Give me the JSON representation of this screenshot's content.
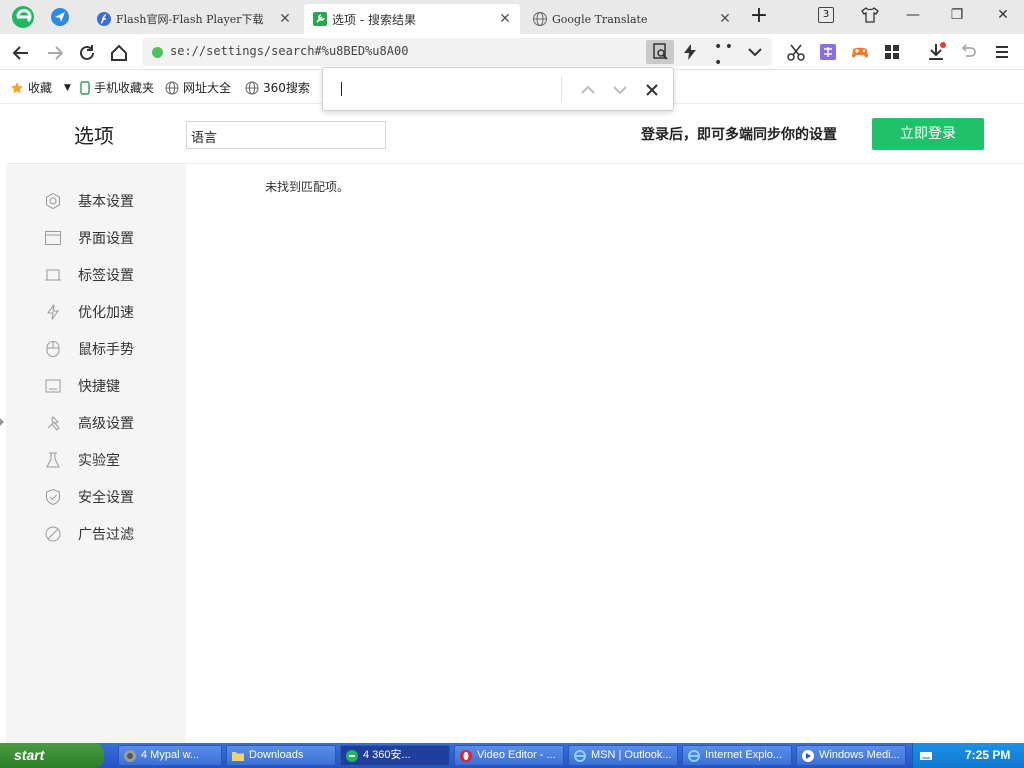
{
  "tabs": [
    {
      "title": "Flash官网-Flash Player下载",
      "icon": "flash-icon"
    },
    {
      "title": "选项 - 搜索结果",
      "icon": "wrench-icon",
      "active": true
    },
    {
      "title": "Google Translate",
      "icon": "globe-icon"
    }
  ],
  "tab_count": "3",
  "address": {
    "url": "se://settings/search#%u8BED%u8A00"
  },
  "bookmarks": [
    {
      "label": "收藏",
      "icon": "star-icon"
    },
    {
      "label": "手机收藏夹",
      "icon": "phone-icon"
    },
    {
      "label": "网址大全",
      "icon": "globe-icon"
    },
    {
      "label": "360搜索",
      "icon": "globe-icon"
    }
  ],
  "find_bar": {
    "value": ""
  },
  "settings": {
    "title": "选项",
    "search_value": "语言",
    "sync_text": "登录后，即可多端同步你的设置",
    "login_button": "立即登录",
    "no_result": "未找到匹配项。",
    "menu": [
      {
        "label": "基本设置",
        "icon": "gear-icon"
      },
      {
        "label": "界面设置",
        "icon": "window-icon"
      },
      {
        "label": "标签设置",
        "icon": "tab-icon"
      },
      {
        "label": "优化加速",
        "icon": "lightning-icon"
      },
      {
        "label": "鼠标手势",
        "icon": "mouse-icon"
      },
      {
        "label": "快捷键",
        "icon": "keyboard-icon"
      },
      {
        "label": "高级设置",
        "icon": "wrench-icon"
      },
      {
        "label": "实验室",
        "icon": "flask-icon"
      },
      {
        "label": "安全设置",
        "icon": "shield-icon"
      },
      {
        "label": "广告过滤",
        "icon": "block-icon"
      }
    ]
  },
  "taskbar": {
    "start_label": "start",
    "tasks": [
      {
        "label": "4 Mypal w...",
        "icon": "mypal-icon"
      },
      {
        "label": "Downloads",
        "icon": "folder-icon"
      },
      {
        "label": "4 360安...",
        "icon": "ie360-icon"
      },
      {
        "label": "Video Editor - ...",
        "icon": "opera-icon"
      },
      {
        "label": "MSN | Outlook...",
        "icon": "ie-icon"
      },
      {
        "label": "Internet Explo...",
        "icon": "ie-icon"
      },
      {
        "label": "Windows Medi...",
        "icon": "media-icon"
      }
    ],
    "clock": "7:25 PM"
  },
  "colors": {
    "accent": "#1fc26b",
    "taskbar": "#2553c2",
    "sidebar": "#f5f5f5"
  }
}
